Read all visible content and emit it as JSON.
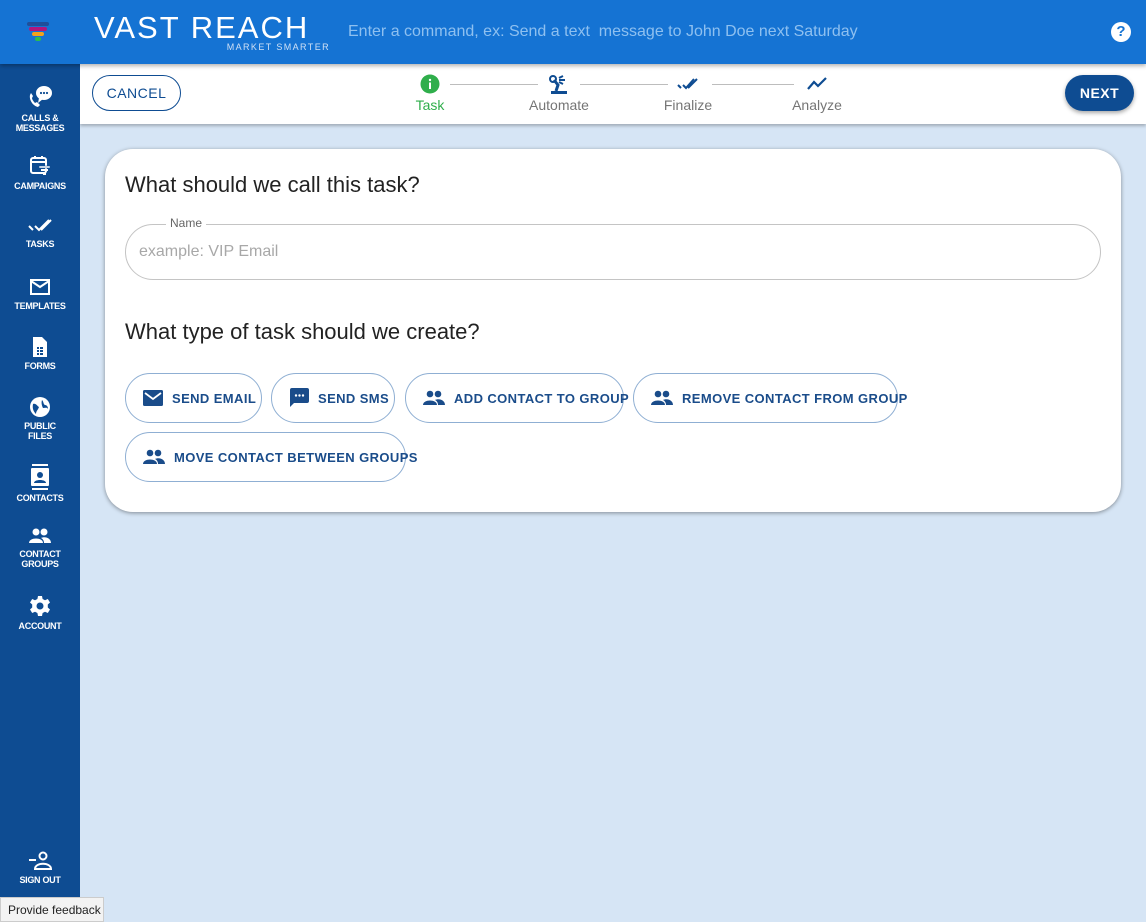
{
  "app": {
    "brand_name": "VAST REACH",
    "brand_tagline": "MARKET SMARTER",
    "command_placeholder": "Enter a command, ex: Send a text  message to John Doe next Saturday",
    "help_label": "?",
    "logo_colors": [
      "#1f4f9a",
      "#b0177c",
      "#f2a21c",
      "#2fbd4a"
    ]
  },
  "sidebar": {
    "items": [
      {
        "icon": "calls-messages-icon",
        "label_lines": [
          "CALLS &",
          "MESSAGES"
        ]
      },
      {
        "icon": "campaigns-icon",
        "label_lines": [
          "CAMPAIGNS"
        ]
      },
      {
        "icon": "tasks-icon",
        "label_lines": [
          "TASKS"
        ]
      },
      {
        "icon": "templates-icon",
        "label_lines": [
          "TEMPLATES"
        ]
      },
      {
        "icon": "forms-icon",
        "label_lines": [
          "FORMS"
        ]
      },
      {
        "icon": "public-files-icon",
        "label_lines": [
          "PUBLIC",
          "FILES"
        ]
      },
      {
        "icon": "contacts-icon",
        "label_lines": [
          "CONTACTS"
        ]
      },
      {
        "icon": "contact-groups-icon",
        "label_lines": [
          "CONTACT",
          "GROUPS"
        ]
      },
      {
        "icon": "account-icon",
        "label_lines": [
          "ACCOUNT"
        ]
      }
    ],
    "sign_out": {
      "icon": "sign-out-icon",
      "label": "SIGN OUT"
    }
  },
  "feedback_label": "Provide feedback",
  "stepper": {
    "cancel_label": "CANCEL",
    "next_label": "NEXT",
    "steps": [
      {
        "label": "Task",
        "icon": "info-icon",
        "active": true
      },
      {
        "label": "Automate",
        "icon": "robot-arm-icon",
        "active": false
      },
      {
        "label": "Finalize",
        "icon": "double-check-icon",
        "active": false
      },
      {
        "label": "Analyze",
        "icon": "trend-icon",
        "active": false
      }
    ],
    "active_color": "#2fae4b",
    "accent_color": "#0e4c92"
  },
  "form": {
    "name_question": "What should we call this task?",
    "name_field": {
      "label": "Name",
      "placeholder": "example: VIP Email",
      "value": ""
    },
    "type_question": "What type of task should we create?",
    "task_types": [
      {
        "label": "SEND EMAIL",
        "icon": "email-icon"
      },
      {
        "label": "SEND SMS",
        "icon": "sms-icon"
      },
      {
        "label": "ADD CONTACT TO GROUP",
        "icon": "group-icon"
      },
      {
        "label": "REMOVE CONTACT FROM GROUP",
        "icon": "group-icon"
      },
      {
        "label": "MOVE CONTACT BETWEEN GROUPS",
        "icon": "group-icon"
      }
    ]
  }
}
